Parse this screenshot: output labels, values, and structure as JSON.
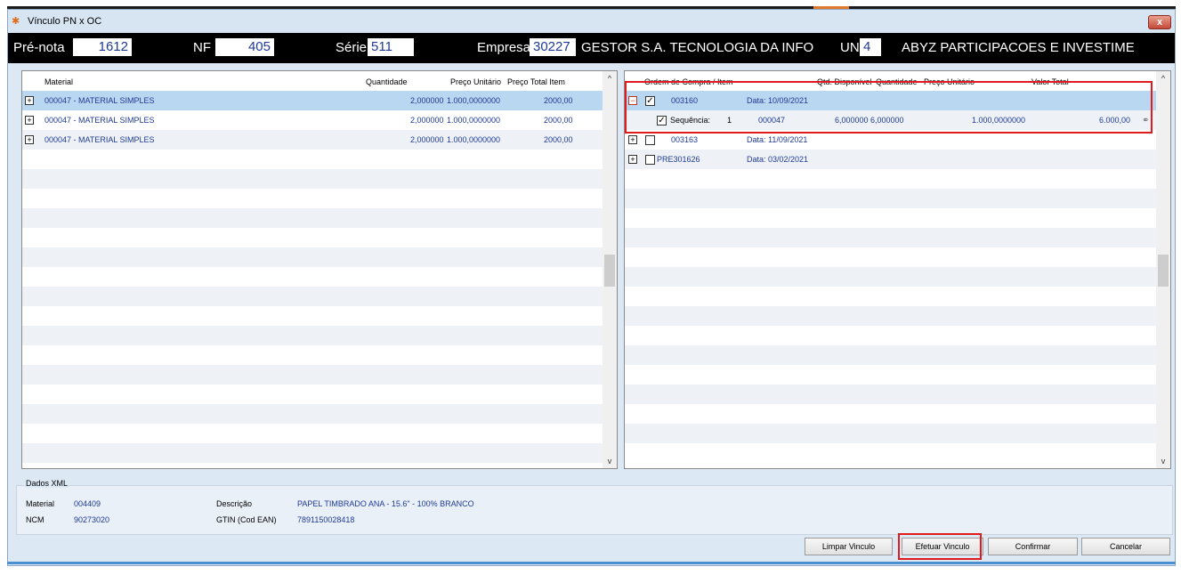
{
  "window": {
    "title": "Vínculo PN x OC",
    "close_label": "x"
  },
  "header": {
    "prenota_label": "Pré-nota",
    "prenota_value": "1612",
    "nf_label": "NF",
    "nf_value": "405",
    "serie_label": "Série",
    "serie_value": "511",
    "empresa_label": "Empresa",
    "empresa_value": "30227",
    "empresa_name": "GESTOR S.A. TECNOLOGIA DA INFO",
    "un_label": "UN",
    "un_value": "4",
    "un_name": "ABYZ PARTICIPACOES E INVESTIME"
  },
  "left_grid": {
    "columns": [
      "Material",
      "Quantidade",
      "Preço Unitário",
      "Preço Total Item"
    ],
    "rows": [
      {
        "material": "000047 - MATERIAL SIMPLES",
        "quantidade": "2,000000",
        "preco_unitario": "1.000,0000000",
        "preco_total": "2000,00"
      },
      {
        "material": "000047 - MATERIAL SIMPLES",
        "quantidade": "2,000000",
        "preco_unitario": "1.000,0000000",
        "preco_total": "2000,00"
      },
      {
        "material": "000047 - MATERIAL SIMPLES",
        "quantidade": "2,000000",
        "preco_unitario": "1.000,0000000",
        "preco_total": "2000,00"
      }
    ]
  },
  "right_grid": {
    "columns": [
      "Ordem de Compra / Item",
      "Qtd. Disponível",
      "Quantidade",
      "Preço Unitário",
      "Valor Total"
    ],
    "orders": [
      {
        "number": "003160",
        "date": "Data: 10/09/2021"
      },
      {
        "number": "003163",
        "date": "Data: 11/09/2021"
      },
      {
        "number": "PRE301626",
        "date": "Data: 03/02/2021"
      }
    ],
    "item": {
      "label": "Sequência:",
      "seq": "1",
      "material": "000047",
      "qtd_disponivel": "6,000000",
      "quantidade": "6,000000",
      "preco_unitario": "1.000,0000000",
      "valor_total": "6.000,00"
    }
  },
  "dados_xml": {
    "legend": "Dados XML",
    "material_label": "Material",
    "material_value": "004409",
    "ncm_label": "NCM",
    "ncm_value": "90273020",
    "descricao_label": "Descrição",
    "descricao_value": "PAPEL TIMBRADO ANA - 15.6\" - 100% BRANCO",
    "gtin_label": "GTIN (Cod EAN)",
    "gtin_value": "7891150028418"
  },
  "buttons": {
    "limpar": "Limpar Vinculo",
    "efetuar": "Efetuar Vinculo",
    "confirmar": "Confirmar",
    "cancelar": "Cancelar"
  },
  "colors": {
    "accent_red": "#e01b1b",
    "selected_row": "#b9d7f1",
    "value_blue": "#1f3a93"
  }
}
